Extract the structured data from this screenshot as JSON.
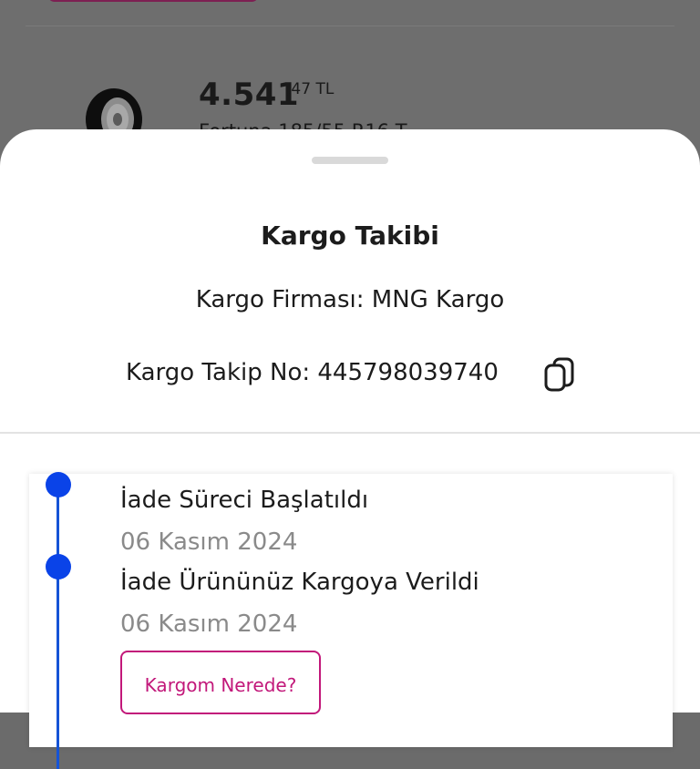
{
  "background": {
    "price_main": "4.541",
    "price_cents": ",47 TL",
    "product_title": "Fortuna 185/55 R16 T"
  },
  "sheet": {
    "title": "Kargo Takibi",
    "company_label": "Kargo Firması:",
    "company_value": "MNG Kargo",
    "tracking_label": "Kargo Takip No:",
    "tracking_value": "445798039740",
    "copy_icon": "copy-icon"
  },
  "timeline": {
    "accent_color": "#0a43e8",
    "steps": [
      {
        "title": "İade Süreci Başlatıldı",
        "date": "06 Kasım 2024"
      },
      {
        "title": "İade Ürününüz Kargoya Verildi",
        "date": "06 Kasım 2024"
      }
    ],
    "button_label": "Kargom Nerede?",
    "button_color": "#c2187a"
  }
}
